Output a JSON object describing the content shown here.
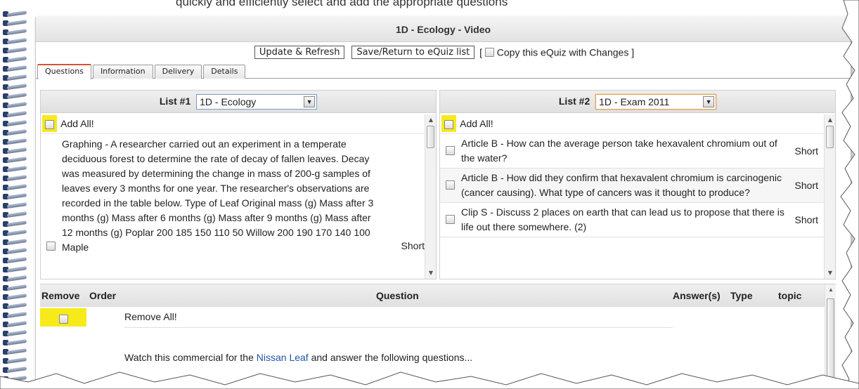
{
  "caption_top": "quickly and efficiently select and add the appropriate questions",
  "window": {
    "title": "1D - Ecology - Video"
  },
  "actions": {
    "update_label": "Update & Refresh",
    "save_label": "Save/Return to eQuiz list",
    "bracket_open": "[",
    "copy_label": "Copy this eQuiz with Changes ]"
  },
  "tabs": [
    {
      "label": "Questions",
      "active": true
    },
    {
      "label": "Information"
    },
    {
      "label": "Delivery"
    },
    {
      "label": "Details"
    }
  ],
  "list1": {
    "label": "List #1",
    "selected": "1D - Ecology",
    "add_all": "Add All!",
    "question": "Graphing - A researcher carried out an experiment in a temperate deciduous forest to determine the rate of decay of fallen leaves. Decay was measured by determining the change in mass of 200-g samples of leaves every 3 months for one year.  The researcher's observations are recorded in the table below. Type of Leaf Original mass (g) Mass after 3 months (g) Mass after 6 months (g) Mass after 9 months (g) Mass after 12 months (g) Poplar 200 185 150 110 50 Willow 200 190 170 140 100 Maple",
    "type": "Short"
  },
  "list2": {
    "label": "List #2",
    "selected": "1D - Exam 2011",
    "add_all": "Add All!",
    "questions": [
      {
        "text": "Article B - How can the average person take hexavalent chromium out of the water?",
        "type": "Short"
      },
      {
        "text": "Article B - How did they confirm that hexavalent chromium is carcinogenic (cancer causing). What type of cancers was it thought to produce?",
        "type": "Short"
      },
      {
        "text": "Clip S - Discuss 2 places on earth that can lead us to propose that there is life out there somewhere. (2)",
        "type": "Short"
      }
    ]
  },
  "quiz_table": {
    "headers": {
      "remove": "Remove",
      "order": "Order",
      "question": "Question",
      "answers": "Answer(s)",
      "type": "Type",
      "topic": "topic"
    },
    "remove_all": "Remove All!",
    "instruction_prefix": "Watch this commercial for the ",
    "instruction_link": "Nissan Leaf",
    "instruction_suffix": " and answer the following questions..."
  },
  "colors": {
    "highlight": "#f7ea1a",
    "active_tab": "#d9532c",
    "link": "#2255aa"
  }
}
